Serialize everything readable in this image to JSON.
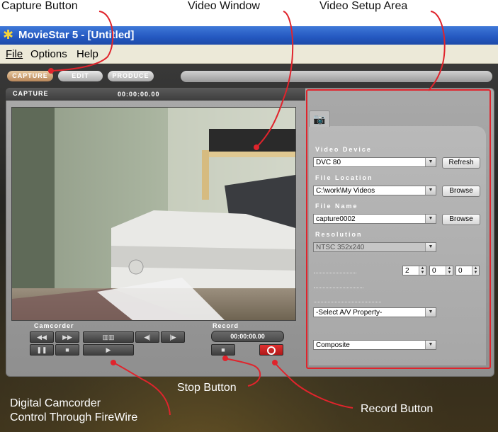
{
  "callouts": {
    "capture_button": "Capture Button",
    "video_window": "Video Window",
    "video_setup_area": "Video Setup Area",
    "stop_button": "Stop Button",
    "record_button": "Record Button",
    "camcorder_line1": "Digital Camcorder",
    "camcorder_line2": "Control Through FireWire"
  },
  "window": {
    "title": "MovieStar 5 - [Untitled]"
  },
  "menu": {
    "file": "File",
    "options": "Options",
    "help": "Help"
  },
  "tabs": {
    "capture": "CAPTURE",
    "edit": "EDIT",
    "produce": "PRODUCE"
  },
  "capture_panel": {
    "title": "CAPTURE",
    "timecode": "00:00:00.00"
  },
  "controls": {
    "camcorder_label": "Camcorder",
    "record_label": "Record",
    "record_timecode": "00:00:00.00"
  },
  "setup": {
    "video_device_label": "Video Device",
    "video_device_value": "DVC 80",
    "refresh_label": "Refresh",
    "file_location_label": "File Location",
    "file_location_value": "C:\\work\\My Videos",
    "browse_label": "Browse",
    "file_name_label": "File Name",
    "file_name_value": "capture0002",
    "resolution_label": "Resolution",
    "resolution_value": "NTSC 352x240",
    "spin_1": "2",
    "spin_2": "0",
    "spin_3": "0",
    "av_property_value": "-Select A/V Property-",
    "input_value": "Composite"
  },
  "colors": {
    "callout_red": "#e0242c",
    "title_blue": "#2458c0"
  }
}
